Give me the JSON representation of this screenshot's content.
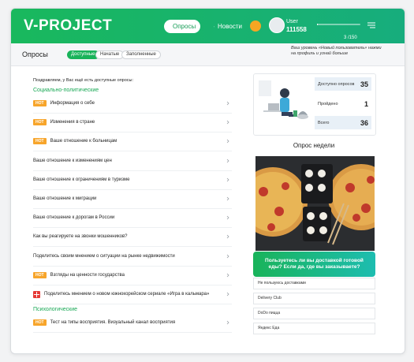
{
  "header": {
    "logo": "V-PROJECT",
    "nav_polls": "Опросы",
    "nav_news": "Новости",
    "user_label": "User",
    "user_id": "111558",
    "progress_text": "3 /150",
    "progress_fraction": 0.02
  },
  "subbar": {
    "title": "Опросы",
    "filters": [
      "Доступные",
      "Начатые",
      "Заполненные"
    ],
    "level_text": "Ваш уровень «Новый пользователь» нажми на профиль и узнай больше"
  },
  "main": {
    "greeting": "Поздравляем, у Вас ещё есть доступные опросы:",
    "section_social": "Социально-политические",
    "section_psych": "Психологические",
    "hot_label": "HOT",
    "surveys": [
      {
        "label": "Информация о себе",
        "hot": true
      },
      {
        "label": "Изменения в стране",
        "hot": true
      },
      {
        "label": "Ваше отношение к больницам",
        "hot": true
      },
      {
        "label": "Ваше отношение к изменениям цен",
        "hot": false
      },
      {
        "label": "Ваше отношение к ограничениям в туризме",
        "hot": false
      },
      {
        "label": "Ваше отношение к миграции",
        "hot": false
      },
      {
        "label": "Ваше отношение к дорогам в России",
        "hot": false
      },
      {
        "label": "Как вы реагируете на звонки мошенников?",
        "hot": false
      },
      {
        "label": "Поделитесь своим мнением о ситуации на рынке недвижимости",
        "hot": false
      },
      {
        "label": "Взгляды на ценности государства",
        "hot": true
      },
      {
        "label": "Поделитесь мнением о новом южнокорейском сериале «Игра в кальмара»",
        "hot": false
      }
    ],
    "psych_surveys": [
      {
        "label": "Тест на типы восприятия. Визуальный канал восприятия",
        "hot": true
      }
    ]
  },
  "stats": {
    "available_label": "Доступно опросов",
    "available_value": "35",
    "done_label": "Пройдено",
    "done_value": "1",
    "total_label": "Всего",
    "total_value": "36"
  },
  "week": {
    "title": "Опрос недели",
    "question": "Пользуетесь ли вы доставкой готовой еды? Если да, где вы заказываете?",
    "options": [
      "Не пользуюсь доставками",
      "Delivery Club",
      "DoDo пицца",
      "Яндекс Еда"
    ]
  },
  "colors": {
    "brand": "#19b35a",
    "hot": "#f7a52b",
    "bell": "#f6a623"
  }
}
